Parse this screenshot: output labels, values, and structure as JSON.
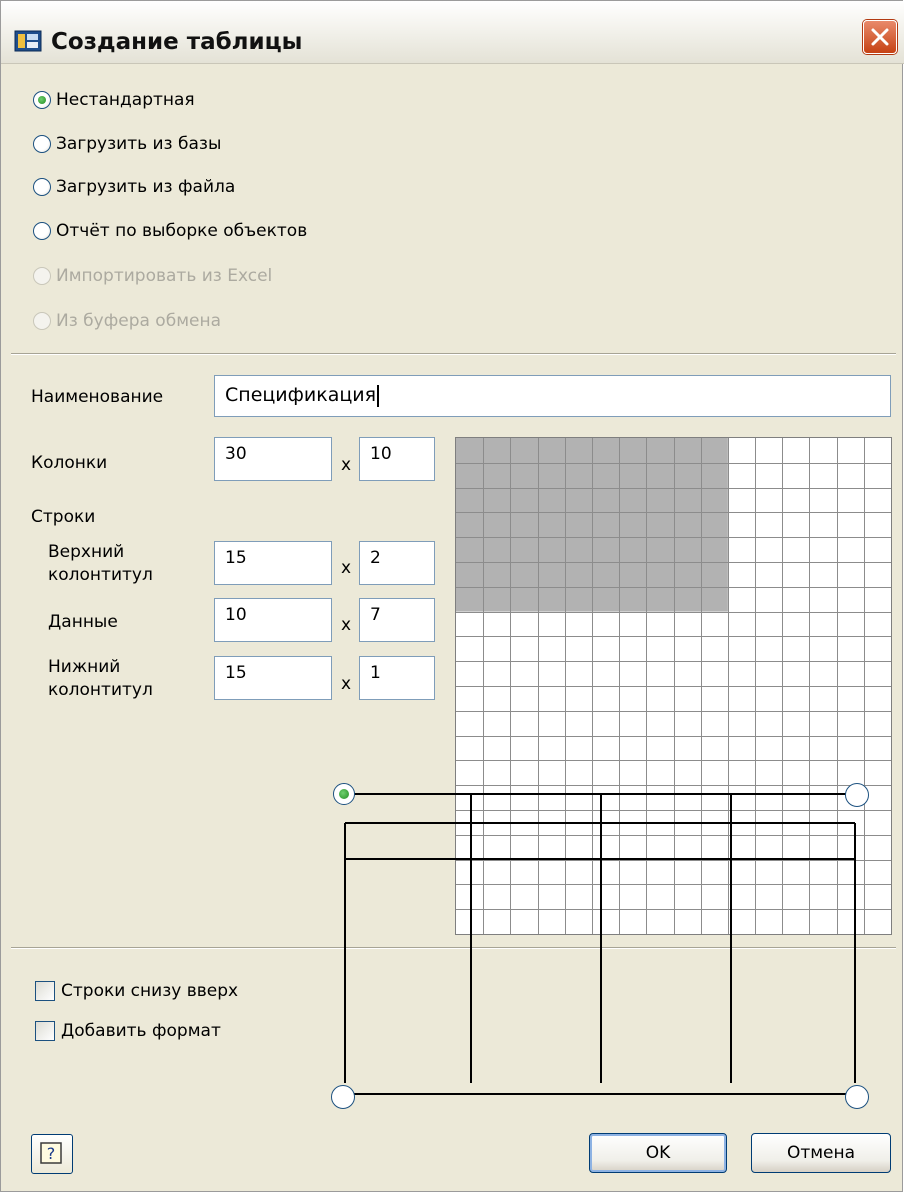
{
  "window": {
    "title": "Создание таблицы"
  },
  "source_options": [
    {
      "label": "Нестандартная",
      "checked": true,
      "enabled": true
    },
    {
      "label": "Загрузить из базы",
      "checked": false,
      "enabled": true
    },
    {
      "label": "Загрузить из файла",
      "checked": false,
      "enabled": true
    },
    {
      "label": "Отчёт по выборке объектов",
      "checked": false,
      "enabled": true
    },
    {
      "label": "Импортировать из Excel",
      "checked": false,
      "enabled": false
    },
    {
      "label": "Из буфера обмена",
      "checked": false,
      "enabled": false
    }
  ],
  "form": {
    "name_label": "Наименование",
    "name_value": "Спецификация",
    "columns_label": "Колонки",
    "columns_width": "30",
    "columns_count": "10",
    "rows_label": "Строки",
    "header_label_line1": "Верхний",
    "header_label_line2": "колонтитул",
    "header_height": "15",
    "header_count": "2",
    "data_label": "Данные",
    "data_height": "10",
    "data_count": "7",
    "footer_label_line1": "Нижний",
    "footer_label_line2": "колонтитул",
    "footer_height": "15",
    "footer_count": "1",
    "times_symbol": "x"
  },
  "grid_preview": {
    "total_columns": 16,
    "total_rows": 20,
    "selected_columns": 10,
    "selected_rows": 7,
    "selected_color": "#b2b2b2",
    "line_color": "#8c8c8c"
  },
  "options": {
    "rows_bottom_up_label": "Строки снизу вверх",
    "rows_bottom_up_checked": false,
    "add_format_label": "Добавить формат",
    "add_format_checked": false
  },
  "origin_diagram": {
    "selected_corner": "top-left",
    "columns": 4,
    "rows": 3,
    "accent": "#2a9d2a"
  },
  "buttons": {
    "ok_label": "OK",
    "cancel_label": "Отмена",
    "help_icon": "help-icon"
  },
  "colors": {
    "dialog_bg": "#ece9d8",
    "close_red": "#c64214",
    "input_border": "#7f9db9"
  }
}
